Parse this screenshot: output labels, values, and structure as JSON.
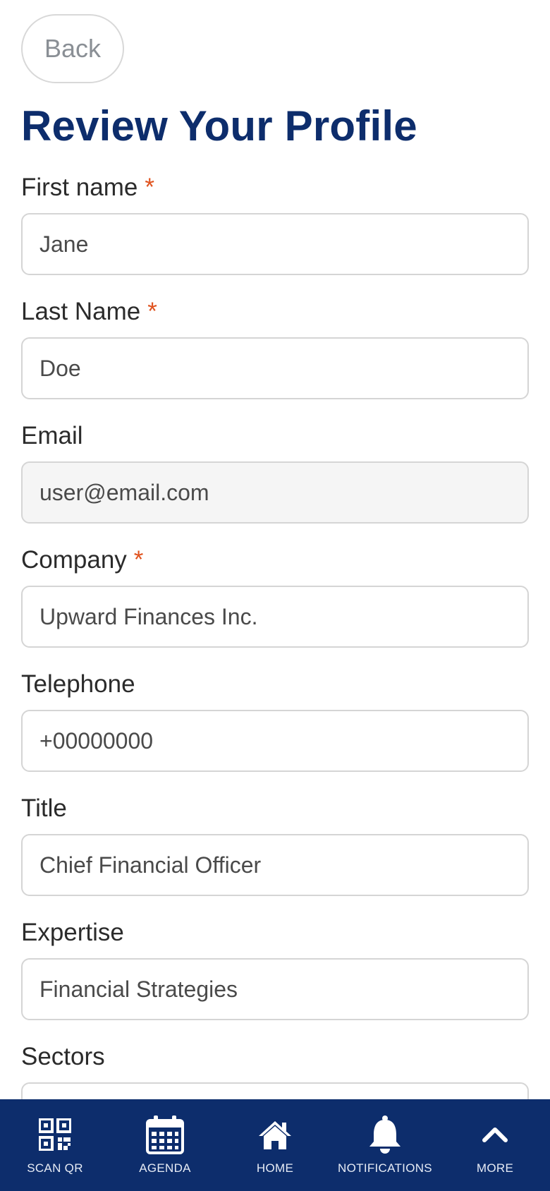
{
  "header": {
    "back_label": "Back",
    "title": "Review Your Profile"
  },
  "form": {
    "required_marker": "*",
    "first_name": {
      "label": "First name",
      "value": "Jane",
      "required": true
    },
    "last_name": {
      "label": "Last Name",
      "value": "Doe",
      "required": true
    },
    "email": {
      "label": "Email",
      "value": "user@email.com",
      "readonly": true
    },
    "company": {
      "label": "Company",
      "value": "Upward Finances Inc.",
      "required": true
    },
    "telephone": {
      "label": "Telephone",
      "value": "+00000000"
    },
    "title": {
      "label": "Title",
      "value": "Chief Financial Officer"
    },
    "expertise": {
      "label": "Expertise",
      "value": "Financial Strategies"
    },
    "sectors": {
      "label": "Sectors",
      "value": ""
    }
  },
  "bottom_nav": {
    "items": [
      {
        "label": "SCAN QR",
        "icon": "qr-code-icon"
      },
      {
        "label": "AGENDA",
        "icon": "calendar-icon"
      },
      {
        "label": "HOME",
        "icon": "home-icon"
      },
      {
        "label": "NOTIFICATIONS",
        "icon": "bell-icon"
      },
      {
        "label": "MORE",
        "icon": "chevron-up-icon"
      }
    ]
  },
  "colors": {
    "brand_navy": "#0d2d6c",
    "required_orange": "#e0531f",
    "readonly_background": "#f5f5f5",
    "border_gray": "#d5d5d5"
  }
}
